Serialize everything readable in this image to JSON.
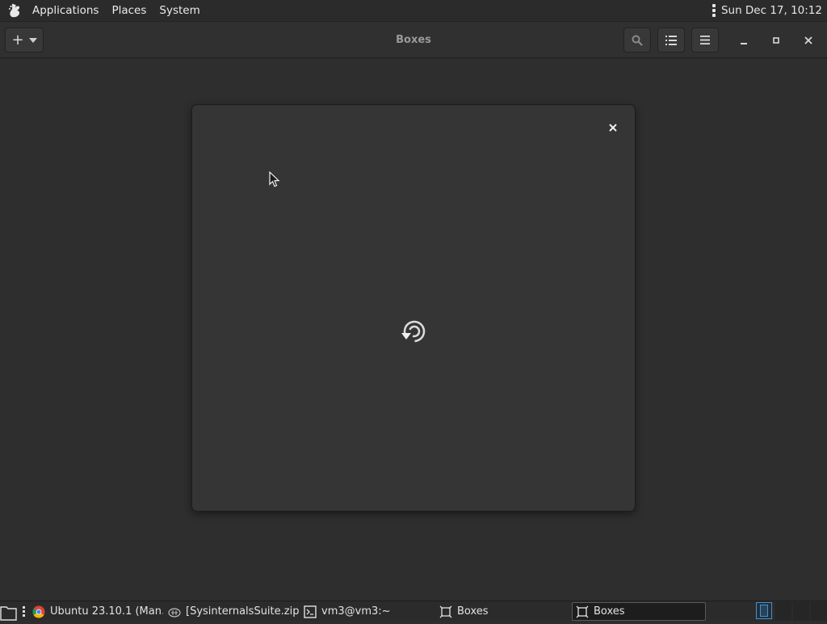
{
  "top_panel": {
    "menus": [
      "Applications",
      "Places",
      "System"
    ],
    "clock": "Sun Dec 17, 10:12"
  },
  "headerbar": {
    "title": "Boxes",
    "new_button": "+"
  },
  "dialog": {
    "state": "loading"
  },
  "taskbar": {
    "tasks": [
      {
        "label": "Ubuntu 23.10.1 (Man…",
        "icon": "chrome-icon"
      },
      {
        "label": "[SysinternalsSuite.zip ]",
        "icon": "archive-icon"
      },
      {
        "label": "vm3@vm3:~",
        "icon": "terminal-icon"
      },
      {
        "label": "Boxes",
        "icon": "boxes-icon"
      },
      {
        "label": "Boxes",
        "icon": "boxes-icon",
        "active": true
      }
    ]
  },
  "colors": {
    "background": "#2e2e2e",
    "panel": "#2b2b2b",
    "dialog": "#353535",
    "workspace_active": "#4a90c8"
  }
}
